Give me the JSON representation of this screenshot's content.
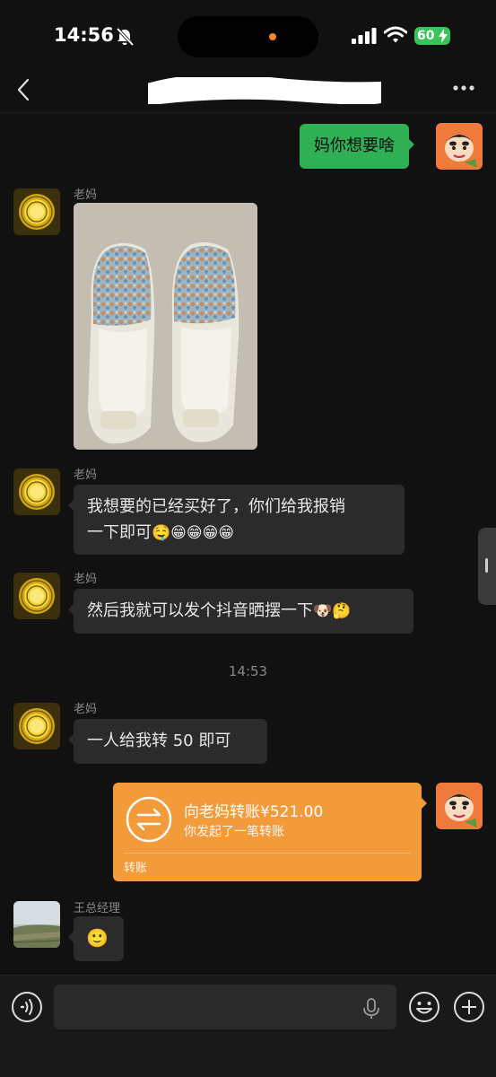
{
  "status": {
    "time": "14:56",
    "battery": "60",
    "icons": [
      "bell-slash-icon",
      "signal-icon",
      "wifi-icon",
      "battery-charging-icon"
    ]
  },
  "header": {
    "title": "",
    "icons": [
      "back-icon",
      "more-icon"
    ]
  },
  "messages": [
    {
      "side": "out",
      "sender": "",
      "text": "妈你想要啥"
    },
    {
      "side": "in",
      "sender": "老妈",
      "type": "image",
      "image": "shoe-photo"
    },
    {
      "side": "in",
      "sender": "老妈",
      "text_line1": "我想要的已经买好了，你们给我报销",
      "text_line2": "一下即可",
      "emojis": "🤤😁😁😁😁"
    },
    {
      "side": "in",
      "sender": "老妈",
      "text": "然后我就可以发个抖音晒摆一下",
      "emojis": "🐶🤔"
    },
    {
      "side": "in",
      "sender": "老妈",
      "text": "一人给我转 50 即可"
    },
    {
      "side": "out",
      "type": "transfer",
      "title": "向老妈转账¥521.00",
      "subtitle": "你发起了一笔转账",
      "label": "转账"
    },
    {
      "side": "in",
      "sender": "王总经理",
      "emojis": "🙂"
    }
  ],
  "time_divider": "14:53",
  "input": {
    "placeholder": "",
    "icons": [
      "voice-icon",
      "mic-icon",
      "emoji-icon",
      "plus-icon"
    ]
  },
  "colors": {
    "background": "#111111",
    "bubble_in": "#2b2b2b",
    "bubble_out": "#2fb055",
    "transfer": "#f39a3a"
  }
}
